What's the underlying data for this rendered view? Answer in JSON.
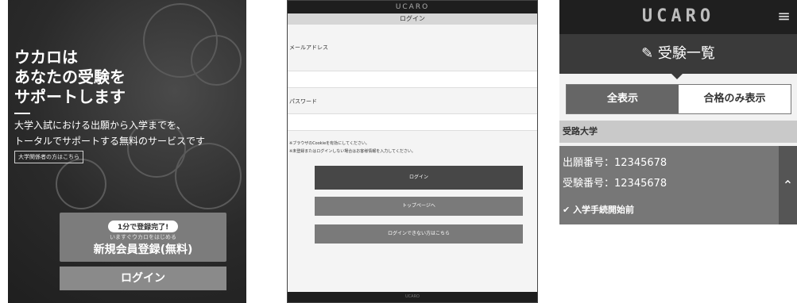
{
  "panel1": {
    "hero_line1": "ウカロは",
    "hero_line2": "あなたの受験を",
    "hero_line3": "サポートします",
    "sub_line1": "大学入試における出願から入学までを、",
    "sub_line2": "トータルでサポートする無料のサービスです",
    "small_button": "大学関係者の方はこちら",
    "signup_badge": "1分で登録完了!",
    "signup_tagline": "いますぐウカロをはじめる",
    "signup_label": "新規会員登録(無料)",
    "login_label": "ログイン"
  },
  "panel2": {
    "logo": "UCARO",
    "title": "ログイン",
    "email_label": "メールアドレス",
    "password_label": "パスワード",
    "note1": "※ブラウザのCookieを有効にしてください。",
    "note2": "※未登録またはログインしない場合はお客様情報を入力してください。",
    "login_button": "ログイン",
    "top_page_button": "トップページへ",
    "cant_login_button": "ログインできない方はこちら",
    "footer": "UCARO"
  },
  "panel3": {
    "logo": "UCARO",
    "page_title": "受験一覧",
    "tab_all": "全表示",
    "tab_passed": "合格のみ表示",
    "university": "受路大学",
    "application_no": "出願番号：12345678",
    "exam_no": "受験番号：12345678",
    "status": "入学手続開始前"
  }
}
